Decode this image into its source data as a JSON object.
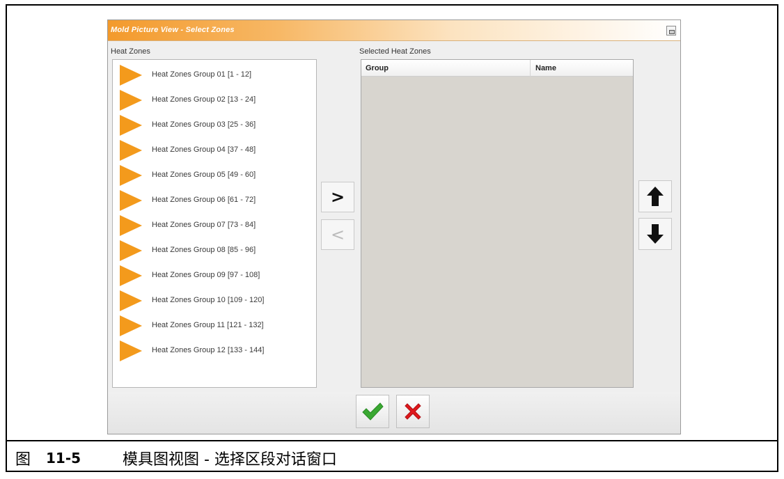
{
  "dialog": {
    "title": "Mold Picture View - Select Zones",
    "heat_zones_label": "Heat Zones",
    "selected_label": "Selected Heat Zones",
    "columns": [
      "Group",
      "Name"
    ],
    "add_label": ">",
    "remove_label": "<",
    "zones": [
      "Heat Zones Group 01 [1 - 12]",
      "Heat Zones Group 02 [13 - 24]",
      "Heat Zones Group 03 [25 - 36]",
      "Heat Zones Group 04 [37 - 48]",
      "Heat Zones Group 05 [49 - 60]",
      "Heat Zones Group 06 [61 - 72]",
      "Heat Zones Group 07 [73 - 84]",
      "Heat Zones Group 08 [85 - 96]",
      "Heat Zones Group 09 [97 - 108]",
      "Heat Zones Group 10 [109 - 120]",
      "Heat Zones Group 11 [121 - 132]",
      "Heat Zones Group 12 [133 - 144]"
    ],
    "icons": {
      "zone": "orange-triangle-icon",
      "up": "arrow-up-icon",
      "down": "arrow-down-icon",
      "ok": "checkmark-icon",
      "cancel": "x-icon"
    },
    "colors": {
      "accent": "#f39a1c",
      "ok": "#3aa832",
      "cancel": "#e0181c"
    }
  },
  "caption": {
    "figure_word": "图",
    "figure_number": "11-5",
    "title": "模具图视图 - 选择区段对话窗口"
  }
}
